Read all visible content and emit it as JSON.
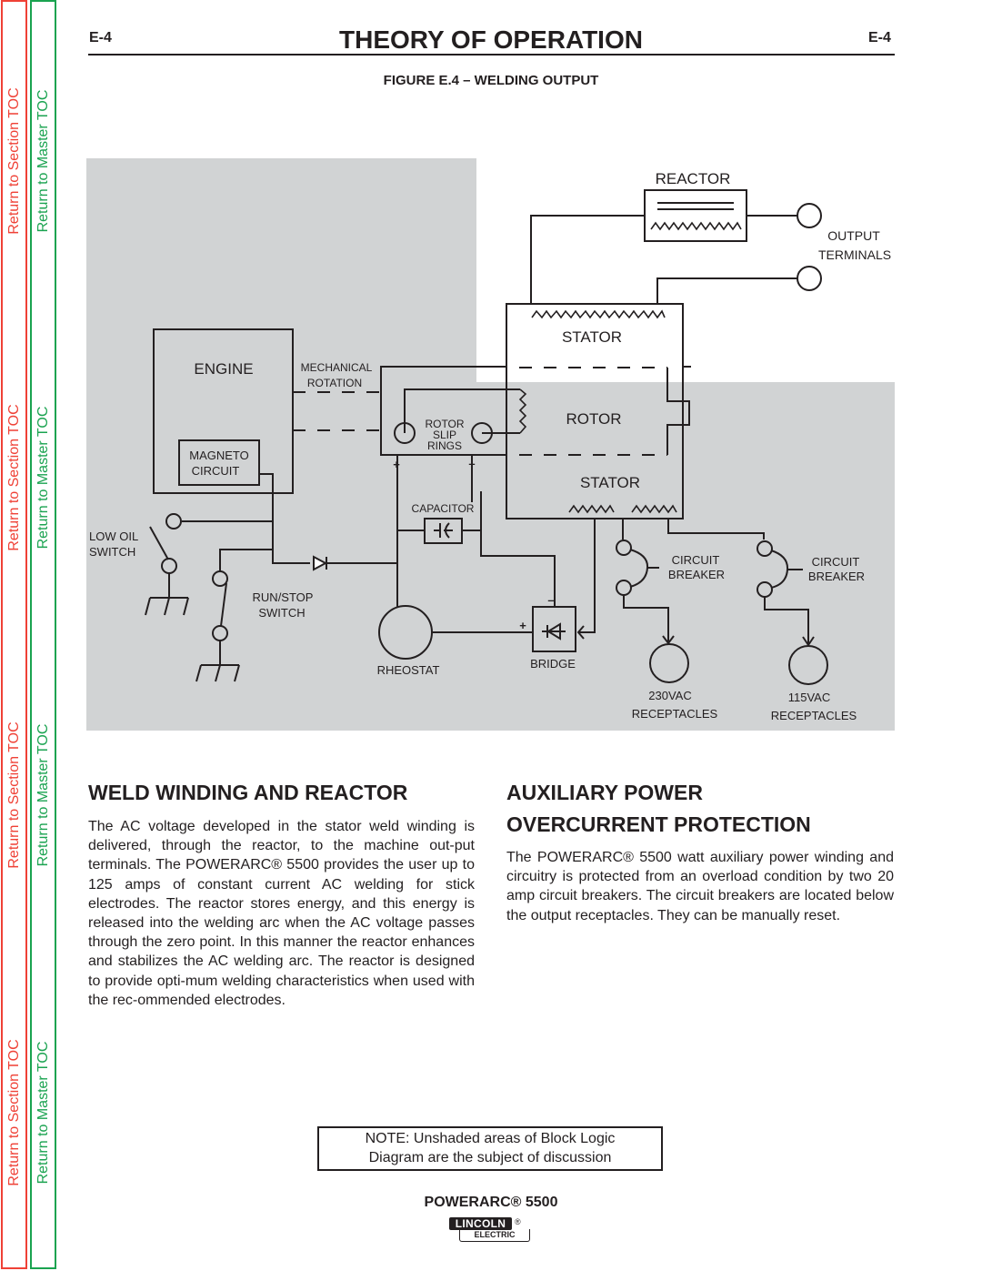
{
  "toc": {
    "section_label": "Return to Section TOC",
    "master_label": "Return to Master TOC",
    "section_color": "#ef4136",
    "master_color": "#1aa350"
  },
  "header": {
    "page_number_left": "E-4",
    "page_number_right": "E-4",
    "title": "THEORY OF OPERATION"
  },
  "figure": {
    "title": "FIGURE E.4 – WELDING OUTPUT",
    "shaded_color": "#d1d3d4",
    "labels": {
      "reactor": "REACTOR",
      "output_terminals_1": "OUTPUT",
      "output_terminals_2": "TERMINALS",
      "stator_top": "STATOR",
      "rotor": "ROTOR",
      "stator_bottom": "STATOR",
      "engine": "ENGINE",
      "magneto_1": "MAGNETO",
      "magneto_2": "CIRCUIT",
      "mechanical_1": "MECHANICAL",
      "mechanical_2": "ROTATION",
      "rotor_slip_1": "ROTOR",
      "rotor_slip_2": "SLIP",
      "rotor_slip_3": "RINGS",
      "plus": "+",
      "minus": "–",
      "capacitor": "CAPACITOR",
      "low_oil_1": "LOW OIL",
      "low_oil_2": "SWITCH",
      "run_stop_1": "RUN/STOP",
      "run_stop_2": "SWITCH",
      "rheostat": "RHEOSTAT",
      "bridge": "BRIDGE",
      "circuit_breaker_1a": "CIRCUIT",
      "circuit_breaker_1b": "BREAKER",
      "circuit_breaker_2a": "CIRCUIT",
      "circuit_breaker_2b": "BREAKER",
      "receptacle_230_a": "230VAC",
      "receptacle_230_b": "RECEPTACLES",
      "receptacle_115_a": "115VAC",
      "receptacle_115_b": "RECEPTACLES"
    }
  },
  "sections": {
    "weld_winding": {
      "heading": "WELD WINDING AND REACTOR",
      "body": "The AC voltage developed in the stator weld winding is delivered, through the reactor, to the machine out-put terminals.  The POWERARC® 5500 provides the user up to 125 amps of constant current AC welding for stick electrodes.  The reactor stores energy, and this energy is released into the welding arc when the AC voltage passes through the zero point.  In this manner the reactor enhances and stabilizes the AC welding arc.  The reactor is designed to provide opti-mum welding characteristics when used with the rec-ommended electrodes."
    },
    "aux_power": {
      "heading_line1": "AUXILIARY POWER",
      "heading_line2": "OVERCURRENT PROTECTION",
      "body": "The POWERARC® 5500 watt auxiliary power winding and circuitry is protected from an overload condition by two 20 amp circuit breakers. The circuit breakers are located below the output receptacles.  They can be manually reset."
    }
  },
  "note": {
    "line1": "NOTE: Unshaded areas of Block Logic",
    "line2": "Diagram are the subject of discussion"
  },
  "footer": {
    "product": "POWERARC® 5500",
    "logo_top": "LINCOLN",
    "logo_bottom": "ELECTRIC",
    "logo_reg": "®"
  }
}
